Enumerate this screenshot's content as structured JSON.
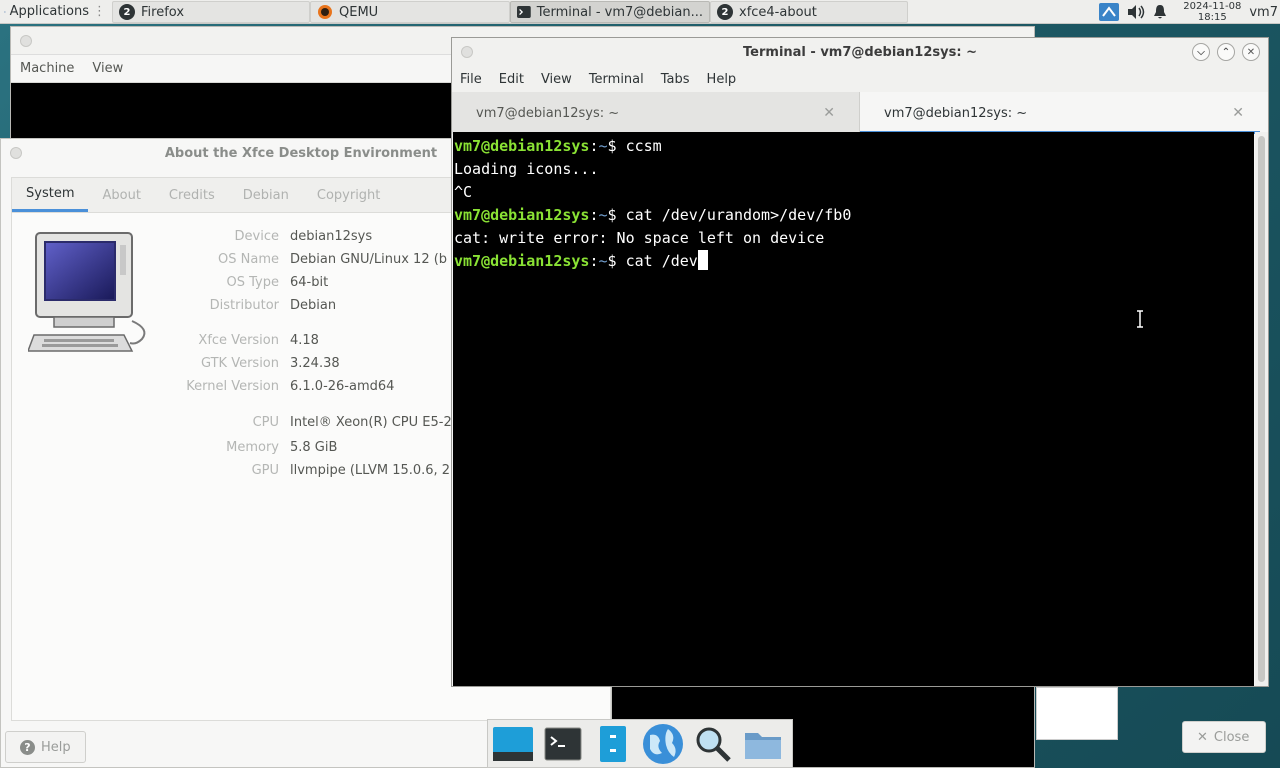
{
  "panel": {
    "apps_label": "Applications",
    "tasks": [
      {
        "label": "Firefox",
        "badge": "2"
      },
      {
        "label": "QEMU"
      },
      {
        "label": "Terminal - vm7@debian..."
      },
      {
        "label": "xfce4-about",
        "badge": "2"
      }
    ],
    "clock_date": "2024-11-08",
    "clock_time": "18:15",
    "user": "vm7"
  },
  "qemu": {
    "menu": [
      "Machine",
      "View"
    ]
  },
  "about": {
    "title": "About the Xfce Desktop Environment",
    "tabs": [
      "System",
      "About",
      "Credits",
      "Debian",
      "Copyright"
    ],
    "active_tab": "System",
    "info": [
      {
        "label": "Device",
        "value": "debian12sys"
      },
      {
        "label": "OS Name",
        "value": "Debian GNU/Linux 12 (b"
      },
      {
        "label": "OS Type",
        "value": "64-bit"
      },
      {
        "label": "Distributor",
        "value": "Debian"
      },
      {
        "label": "Xfce Version",
        "value": "4.18"
      },
      {
        "label": "GTK Version",
        "value": "3.24.38"
      },
      {
        "label": "Kernel Version",
        "value": "6.1.0-26-amd64"
      },
      {
        "label": "CPU",
        "value": "Intel® Xeon(R) CPU E5-2"
      },
      {
        "label": "Memory",
        "value": "5.8 GiB"
      },
      {
        "label": "GPU",
        "value": "llvmpipe (LLVM 15.0.6, 2"
      }
    ],
    "help_label": "Help",
    "close_label": "Close"
  },
  "terminal": {
    "title": "Terminal - vm7@debian12sys: ~",
    "menu": [
      "File",
      "Edit",
      "View",
      "Terminal",
      "Tabs",
      "Help"
    ],
    "tabs": [
      "vm7@debian12sys: ~",
      "vm7@debian12sys: ~"
    ],
    "prompt_user": "vm7@debian12sys",
    "prompt_colon": ":",
    "prompt_tilde": "~",
    "prompt_dollar": "$ ",
    "lines": [
      {
        "type": "prompt",
        "cmd": "ccsm"
      },
      {
        "type": "out",
        "text": "Loading icons..."
      },
      {
        "type": "out",
        "text": "^C"
      },
      {
        "type": "prompt",
        "cmd": "cat /dev/urandom>/dev/fb0"
      },
      {
        "type": "out",
        "text": "cat: write error: No space left on device"
      },
      {
        "type": "prompt",
        "cmd": "cat /dev"
      }
    ]
  },
  "dock": [
    "show-desktop-icon",
    "terminal-icon",
    "file-manager-icon",
    "web-browser-icon",
    "app-finder-icon",
    "folder-icon"
  ],
  "colors": {
    "prompt_user": "#8ae234",
    "prompt_tilde": "#729fcf",
    "accent": "#4a90d9"
  }
}
